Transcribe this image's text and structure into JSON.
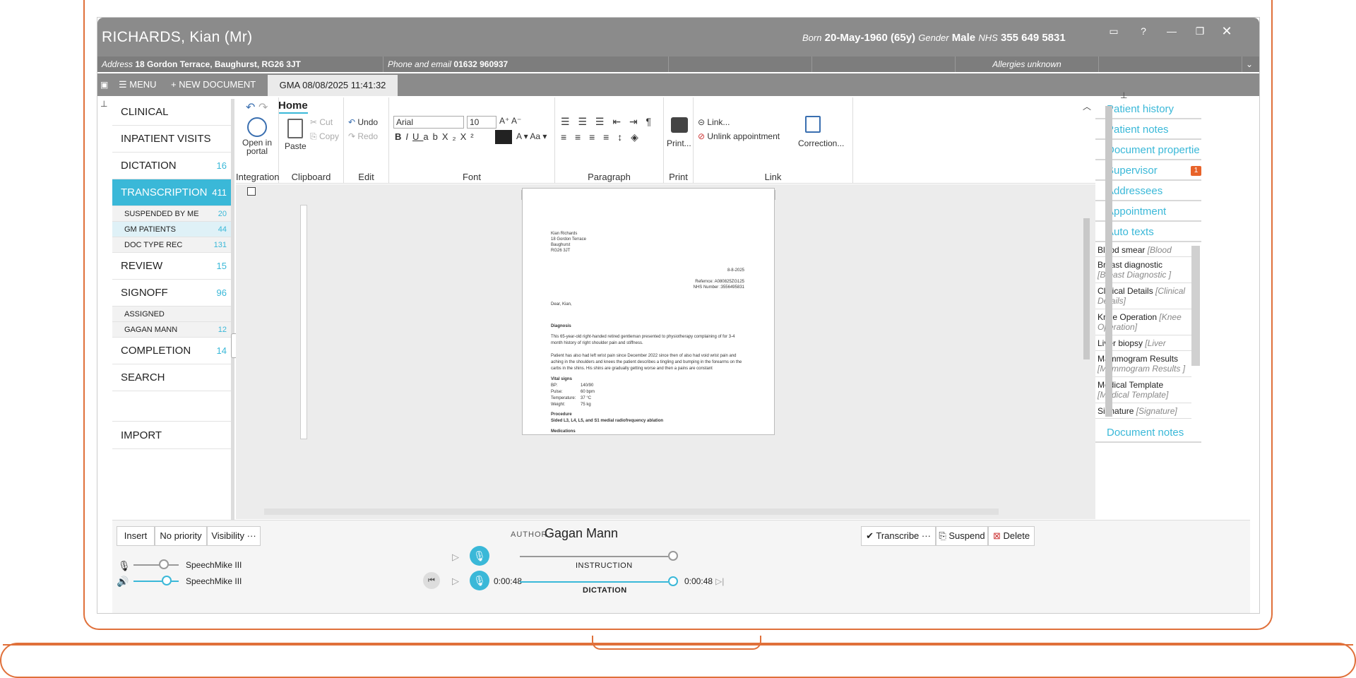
{
  "patient": {
    "name": "RICHARDS, Kian (Mr)",
    "born_label": "Born",
    "born_value": "20-May-1960 (65y)",
    "gender_label": "Gender",
    "gender_value": "Male",
    "nhs_label": "NHS",
    "nhs_value": "355 649 5831",
    "address_label": "Address",
    "address_value": "18 Gordon Terrace, Baughurst, RG26 3JT",
    "phone_label": "Phone and email",
    "phone_value": "01632 960937",
    "allergies": "Allergies unknown"
  },
  "menubar": {
    "menu_label": "MENU",
    "new_document_label": "+ NEW DOCUMENT",
    "doc_tab": "GMA 08/08/2025 11:41:32"
  },
  "sidebar": {
    "items": [
      {
        "label": "CLINICAL",
        "count": ""
      },
      {
        "label": "INPATIENT VISITS",
        "count": ""
      },
      {
        "label": "DICTATION",
        "count": "16"
      },
      {
        "label": "TRANSCRIPTION",
        "count": "411"
      },
      {
        "label": "SUSPENDED BY ME",
        "count": "20"
      },
      {
        "label": "GM PATIENTS",
        "count": "44"
      },
      {
        "label": "DOC TYPE REC",
        "count": "131"
      },
      {
        "label": "REVIEW",
        "count": "15"
      },
      {
        "label": "SIGNOFF",
        "count": "96"
      },
      {
        "label": "ASSIGNED",
        "count": ""
      },
      {
        "label": "GAGAN MANN",
        "count": "12"
      },
      {
        "label": "COMPLETION",
        "count": "14"
      },
      {
        "label": "SEARCH",
        "count": ""
      },
      {
        "label": "IMPORT",
        "count": ""
      }
    ]
  },
  "ribbon": {
    "tab": "Home",
    "integration": {
      "open_portal": "Open in portal",
      "group": "Integration"
    },
    "clipboard": {
      "paste": "Paste",
      "cut": "Cut",
      "copy": "Copy",
      "group": "Clipboard"
    },
    "edit": {
      "undo": "Undo",
      "redo": "Redo",
      "group": "Edit"
    },
    "font": {
      "family": "Arial",
      "size": "10",
      "group": "Font"
    },
    "paragraph": {
      "group": "Paragraph"
    },
    "print": {
      "print": "Print...",
      "group": "Print"
    },
    "link": {
      "link": "Link...",
      "unlink": "Unlink appointment",
      "correction": "Correction...",
      "group": "Link"
    }
  },
  "letter": {
    "addr1": "Kian Richards",
    "addr2": "18 Gordon Terrace",
    "addr3": "Baughurst",
    "addr4": "RG26 3JT",
    "date": "8-8-2025",
    "reference": "Refernce: A080825ZG125",
    "nhs": "NHS Number :3556495831",
    "salutation": "Dear, Kian,",
    "diagnosis_head": "Diagnosis",
    "diag1": "This 65-year-old right-handed retired gentleman presented to physiotherapy complaining of for 3-4",
    "diag2": "month history of right shoulder pain and stiffness.",
    "diag3": "Patient has also had left wrist pain since December 2022 since then of also had void wrist pain and",
    "diag4": "aching in the shoulders and knees the patient describes a tingling and bumping in the forearms on the",
    "diag5": "carbs in the shins. His shins are gradually getting worse and then a pains are constant",
    "vitals_head": "Vital signs",
    "bp_label": "BP:",
    "bp_value": "140/90",
    "pulse_label": "Pulse:",
    "pulse_value": "60 bpm",
    "temp_label": "Temperature:",
    "temp_value": "37 °C",
    "weight_label": "Weight:",
    "weight_value": "75 kg",
    "procedure_head": "Procedure",
    "procedure_text": "Sided L3, L4, L5, and S1 medial radiofrequency ablation",
    "medications_head": "Medications"
  },
  "right_panel": {
    "links": [
      "Patient history",
      "Patient notes",
      "Document propertie",
      "Supervisor",
      "Addressees",
      "Appointment",
      "Auto texts"
    ],
    "supervisor_badge": "1",
    "autotexts": [
      {
        "name": "Blood smear",
        "tag": "[Blood smear]"
      },
      {
        "name": "Breast diagnostic",
        "tag": "[Breast Diagnostic ]"
      },
      {
        "name": "Clinical Details",
        "tag": "[Clinical Details]"
      },
      {
        "name": "Knee Operation",
        "tag": "[Knee Operation]"
      },
      {
        "name": "Liver biopsy",
        "tag": "[Liver biopsy]"
      },
      {
        "name": "Mammogram Results",
        "tag": "[Mammogram Results ]"
      },
      {
        "name": "Medical Template",
        "tag": "[Medical Template]"
      },
      {
        "name": "Signature",
        "tag": "[Signature]"
      }
    ],
    "document_notes": "Document notes"
  },
  "bottom": {
    "insert": "Insert",
    "priority": "No priority",
    "visibility": "Visibility",
    "author_label": "AUTHOR :",
    "author_value": "Gagan Mann",
    "transcribe": "Transcribe",
    "suspend": "Suspend",
    "delete": "Delete",
    "mic_device": "SpeechMike III",
    "speaker_device": "SpeechMike III",
    "instruction_label": "INSTRUCTION",
    "dictation_label": "DICTATION",
    "time_start": "0:00:48",
    "time_end": "0:00:48"
  },
  "colors": {
    "accent": "#3ab8d8",
    "badge": "#e8632a",
    "titlebar": "#8b8b8b",
    "frame": "#e0703a"
  }
}
